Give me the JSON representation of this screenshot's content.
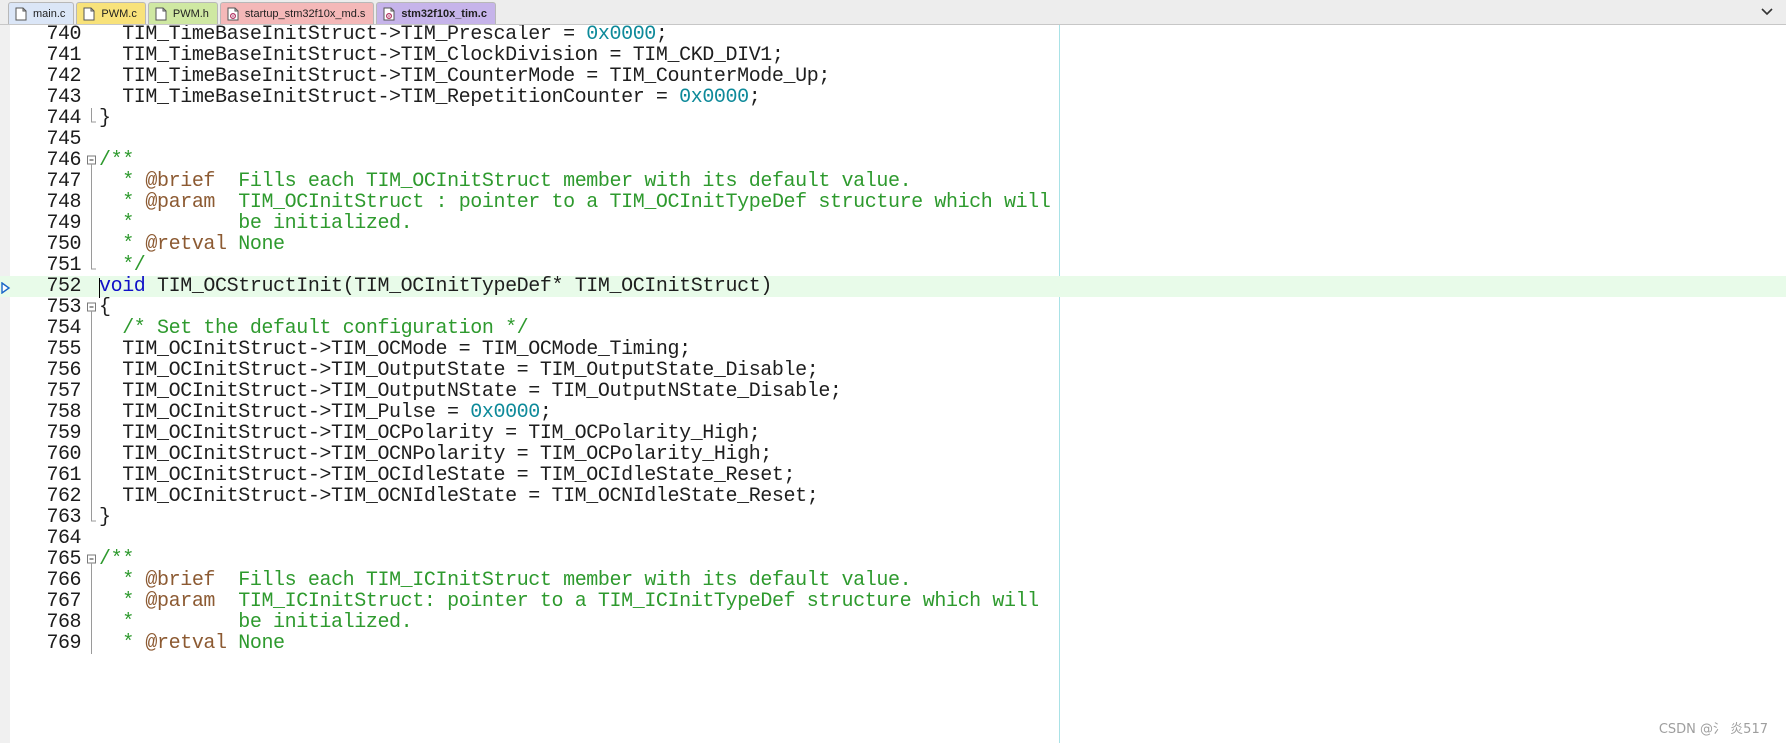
{
  "tabs": [
    {
      "label": "main.c",
      "color": "#dbe6f7",
      "icon": "file-icon",
      "active": false
    },
    {
      "label": "PWM.c",
      "color": "#f8e27a",
      "icon": "file-icon",
      "active": false
    },
    {
      "label": "PWM.h",
      "color": "#cfe8a2",
      "icon": "file-icon",
      "active": false
    },
    {
      "label": "startup_stm32f10x_md.s",
      "color": "#f4b8b8",
      "icon": "gear-file-icon",
      "active": false
    },
    {
      "label": "stm32f10x_tim.c",
      "color": "#c6b4ea",
      "icon": "gear-file-icon",
      "active": true
    }
  ],
  "tab_menu_icon": "chevron-down-icon",
  "colors": {
    "number": "#0e8a9a",
    "comment": "#2e9a2e",
    "doc_tag": "#8c5a32",
    "keyword": "#1010c8",
    "current_line_bg": "#e8fbe9",
    "print_margin": "#a9e2e6"
  },
  "editor": {
    "current_line": "752",
    "lines": [
      {
        "num": "740",
        "segs": [
          [
            "t",
            "  TIM_TimeBaseInitStruct->TIM_Prescaler = "
          ],
          [
            "n",
            "0x0000"
          ],
          [
            "t",
            ";"
          ]
        ]
      },
      {
        "num": "741",
        "segs": [
          [
            "t",
            "  TIM_TimeBaseInitStruct->TIM_ClockDivision = TIM_CKD_DIV1;"
          ]
        ]
      },
      {
        "num": "742",
        "segs": [
          [
            "t",
            "  TIM_TimeBaseInitStruct->TIM_CounterMode = TIM_CounterMode_Up;"
          ]
        ]
      },
      {
        "num": "743",
        "segs": [
          [
            "t",
            "  TIM_TimeBaseInitStruct->TIM_RepetitionCounter = "
          ],
          [
            "n",
            "0x0000"
          ],
          [
            "t",
            ";"
          ]
        ]
      },
      {
        "num": "744",
        "fold": "end",
        "segs": [
          [
            "t",
            "}"
          ]
        ]
      },
      {
        "num": "745",
        "segs": []
      },
      {
        "num": "746",
        "fold": "start",
        "segs": [
          [
            "c",
            "/**"
          ]
        ]
      },
      {
        "num": "747",
        "fold": "line",
        "segs": [
          [
            "c",
            "  * "
          ],
          [
            "d",
            "@brief"
          ],
          [
            "c",
            "  Fills each TIM_OCInitStruct member with its default value."
          ]
        ]
      },
      {
        "num": "748",
        "fold": "line",
        "segs": [
          [
            "c",
            "  * "
          ],
          [
            "d",
            "@param"
          ],
          [
            "c",
            "  TIM_OCInitStruct : pointer to a TIM_OCInitTypeDef structure which will"
          ]
        ]
      },
      {
        "num": "749",
        "fold": "line",
        "segs": [
          [
            "c",
            "  *         be initialized."
          ]
        ]
      },
      {
        "num": "750",
        "fold": "line",
        "segs": [
          [
            "c",
            "  * "
          ],
          [
            "d",
            "@retval"
          ],
          [
            "c",
            " None"
          ]
        ]
      },
      {
        "num": "751",
        "fold": "end",
        "segs": [
          [
            "c",
            "  */"
          ]
        ]
      },
      {
        "num": "752",
        "segs": [
          [
            "k",
            "void"
          ],
          [
            "t",
            " TIM_OCStructInit(TIM_OCInitTypeDef* TIM_OCInitStruct)"
          ]
        ]
      },
      {
        "num": "753",
        "fold": "start",
        "segs": [
          [
            "t",
            "{"
          ]
        ]
      },
      {
        "num": "754",
        "fold": "line",
        "segs": [
          [
            "c",
            "  /* Set the default configuration */"
          ]
        ]
      },
      {
        "num": "755",
        "fold": "line",
        "segs": [
          [
            "t",
            "  TIM_OCInitStruct->TIM_OCMode = TIM_OCMode_Timing;"
          ]
        ]
      },
      {
        "num": "756",
        "fold": "line",
        "segs": [
          [
            "t",
            "  TIM_OCInitStruct->TIM_OutputState = TIM_OutputState_Disable;"
          ]
        ]
      },
      {
        "num": "757",
        "fold": "line",
        "segs": [
          [
            "t",
            "  TIM_OCInitStruct->TIM_OutputNState = TIM_OutputNState_Disable;"
          ]
        ]
      },
      {
        "num": "758",
        "fold": "line",
        "segs": [
          [
            "t",
            "  TIM_OCInitStruct->TIM_Pulse = "
          ],
          [
            "n",
            "0x0000"
          ],
          [
            "t",
            ";"
          ]
        ]
      },
      {
        "num": "759",
        "fold": "line",
        "segs": [
          [
            "t",
            "  TIM_OCInitStruct->TIM_OCPolarity = TIM_OCPolarity_High;"
          ]
        ]
      },
      {
        "num": "760",
        "fold": "line",
        "segs": [
          [
            "t",
            "  TIM_OCInitStruct->TIM_OCNPolarity = TIM_OCPolarity_High;"
          ]
        ]
      },
      {
        "num": "761",
        "fold": "line",
        "segs": [
          [
            "t",
            "  TIM_OCInitStruct->TIM_OCIdleState = TIM_OCIdleState_Reset;"
          ]
        ]
      },
      {
        "num": "762",
        "fold": "line",
        "segs": [
          [
            "t",
            "  TIM_OCInitStruct->TIM_OCNIdleState = TIM_OCNIdleState_Reset;"
          ]
        ]
      },
      {
        "num": "763",
        "fold": "end",
        "segs": [
          [
            "t",
            "}"
          ]
        ]
      },
      {
        "num": "764",
        "segs": []
      },
      {
        "num": "765",
        "fold": "start",
        "segs": [
          [
            "c",
            "/**"
          ]
        ]
      },
      {
        "num": "766",
        "fold": "line",
        "segs": [
          [
            "c",
            "  * "
          ],
          [
            "d",
            "@brief"
          ],
          [
            "c",
            "  Fills each TIM_ICInitStruct member with its default value."
          ]
        ]
      },
      {
        "num": "767",
        "fold": "line",
        "segs": [
          [
            "c",
            "  * "
          ],
          [
            "d",
            "@param"
          ],
          [
            "c",
            "  TIM_ICInitStruct: pointer to a TIM_ICInitTypeDef structure which will"
          ]
        ]
      },
      {
        "num": "768",
        "fold": "line",
        "segs": [
          [
            "c",
            "  *         be initialized."
          ]
        ]
      },
      {
        "num": "769",
        "fold": "line",
        "segs": [
          [
            "c",
            "  * "
          ],
          [
            "d",
            "@retval"
          ],
          [
            "c",
            " None"
          ]
        ]
      }
    ]
  },
  "watermark": "CSDN @氵 炎517"
}
